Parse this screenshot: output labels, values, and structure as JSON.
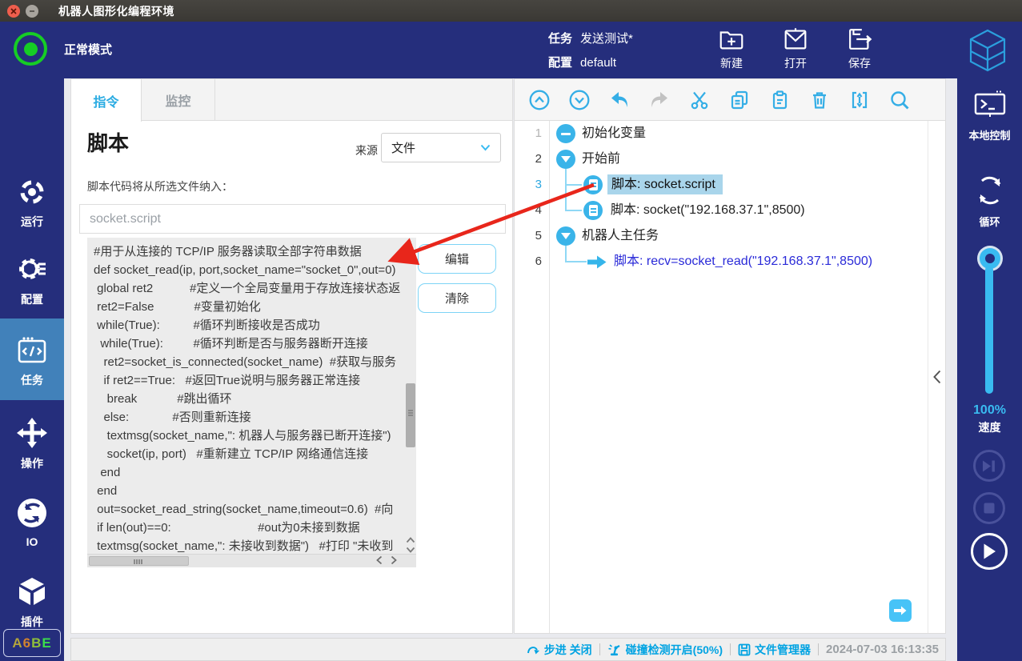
{
  "window": {
    "title": "机器人图形化编程环境"
  },
  "header": {
    "mode": "正常模式",
    "task_label": "任务",
    "task_value": "发送测试*",
    "config_label": "配置",
    "config_value": "default",
    "new_button": "新建",
    "open_button": "打开",
    "save_button": "保存"
  },
  "left_sidebar": {
    "run": "运行",
    "config": "配置",
    "task": "任务",
    "operate": "操作",
    "io": "IO",
    "plugin": "插件",
    "badge_letters": [
      "A",
      "6",
      "B",
      "E"
    ]
  },
  "main": {
    "tab_instruction": "指令",
    "tab_monitor": "监控",
    "title": "脚本",
    "source_label": "来源",
    "source_value": "文件",
    "description": "脚本代码将从所选文件纳入：",
    "filename": "socket.script",
    "edit_button": "编辑",
    "clear_button": "清除",
    "code_lines": [
      "#用于从连接的 TCP/IP 服务器读取全部字符串数据",
      "def socket_read(ip, port,socket_name=\"socket_0\",out=0)",
      " global ret2           #定义一个全局变量用于存放连接状态返",
      " ret2=False            #变量初始化",
      " while(True):          #循环判断接收是否成功",
      "  while(True):         #循环判断是否与服务器断开连接",
      "   ret2=socket_is_connected(socket_name)  #获取与服务",
      "   if ret2==True:   #返回True说明与服务器正常连接",
      "    break            #跳出循环",
      "   else:             #否则重新连接",
      "    textmsg(socket_name,\": 机器人与服务器已断开连接\")",
      "    socket(ip, port)   #重新建立 TCP/IP 网络通信连接",
      "  end",
      " end",
      " out=socket_read_string(socket_name,timeout=0.6)  #向",
      " if len(out)==0:                          #out为0未接到数据",
      " textmsg(socket_name,\": 未接收到数据\")   #打印 \"未收到"
    ]
  },
  "tree": {
    "rows": [
      {
        "num": "1",
        "label": "初始化变量"
      },
      {
        "num": "2",
        "label": "开始前"
      },
      {
        "num": "3",
        "label": "脚本: socket.script"
      },
      {
        "num": "4",
        "label": "脚本: socket(\"192.168.37.1\",8500)"
      },
      {
        "num": "5",
        "label": "机器人主任务"
      },
      {
        "num": "6",
        "label": "脚本: recv=socket_read(\"192.168.37.1\",8500)"
      }
    ]
  },
  "right_sidebar": {
    "local_control": "本地控制",
    "loop": "循环",
    "speed_value": "100%",
    "speed_label": "速度"
  },
  "status_bar": {
    "step": "步进 关闭",
    "collision": "碰撞检测开启(50%)",
    "file_manager": "文件管理器",
    "timestamp": "2024-07-03 16:13:35"
  },
  "colors": {
    "navy": "#252e7c",
    "accent_cyan": "#2fa8e1",
    "active_item_blue": "#4181ba",
    "selected_row_bg": "#a9d5eb",
    "tree_link_blue": "#2a2ad8",
    "arrow_red": "#e8261b",
    "status_green": "#16cd25"
  }
}
